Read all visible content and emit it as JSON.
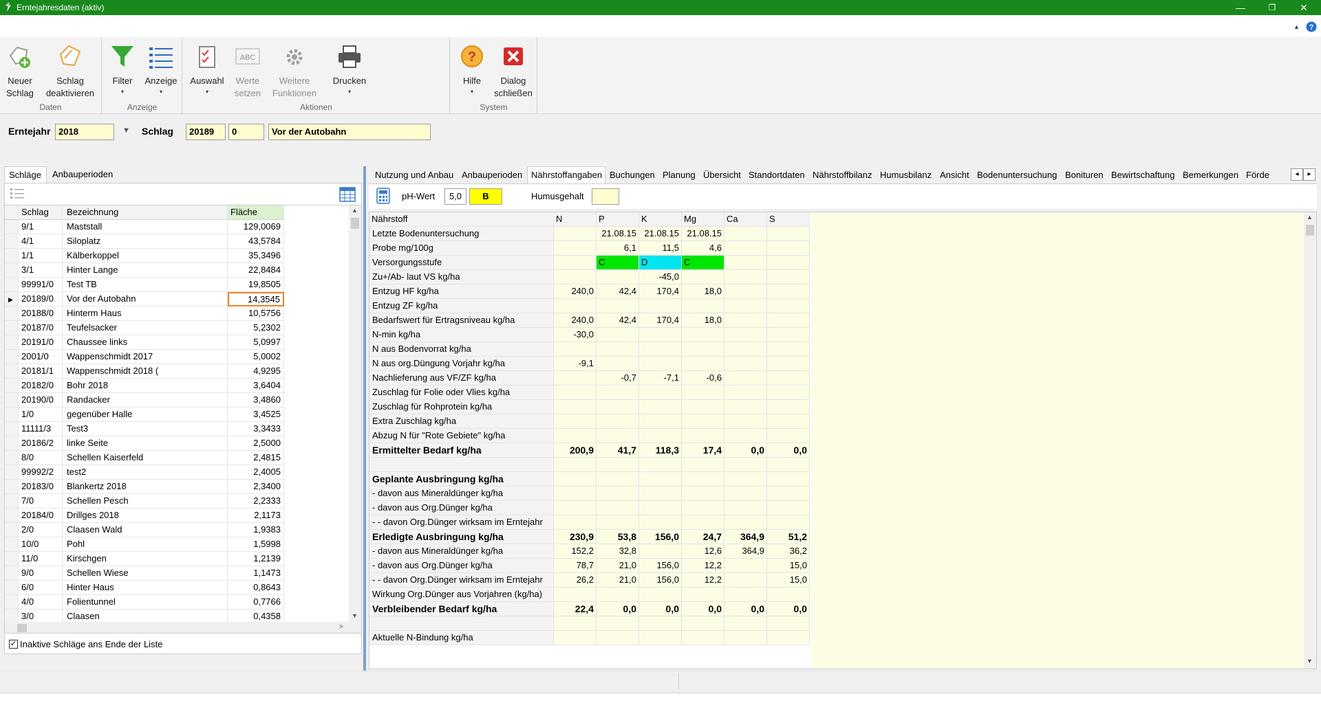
{
  "window": {
    "title": "Erntejahresdaten (aktiv)",
    "minimize": "—",
    "maximize": "❐",
    "close": "✕"
  },
  "ribbon": {
    "groups": {
      "daten": "Daten",
      "anzeige": "Anzeige",
      "aktionen": "Aktionen",
      "system": "System"
    },
    "buttons": {
      "neuer_schlag": "Neuer\nSchlag",
      "schlag_deaktivieren": "Schlag\ndeaktivieren",
      "filter": "Filter",
      "anzeige": "Anzeige",
      "auswahl": "Auswahl",
      "werte_setzen": "Werte\nsetzen",
      "weitere_funktionen": "Weitere\nFunktionen",
      "drucken": "Drucken",
      "hilfe": "Hilfe",
      "dialog_schliessen": "Dialog\nschließen"
    },
    "dropdown_arrow": "▾"
  },
  "header": {
    "erntejahr_label": "Erntejahr",
    "erntejahr_value": "2018",
    "schlag_label": "Schlag",
    "schlag_nr": "20189",
    "schlag_sub": "0",
    "schlag_name": "Vor der Autobahn"
  },
  "left": {
    "tabs": [
      "Schläge",
      "Anbauperioden"
    ],
    "columns": [
      "Schlag",
      "Bezeichnung",
      "Fläche"
    ],
    "rows": [
      [
        "9/1",
        "Maststall",
        "129,0069"
      ],
      [
        "4/1",
        "Siloplatz",
        "43,5784"
      ],
      [
        "1/1",
        "Kälberkoppel",
        "35,3496"
      ],
      [
        "3/1",
        "Hinter Lange",
        "22,8484"
      ],
      [
        "99991/0",
        "Test TB",
        "19,8505"
      ],
      [
        "20189/0",
        "Vor der Autobahn",
        "14,3545"
      ],
      [
        "20188/0",
        "Hinterm Haus",
        "10,5756"
      ],
      [
        "20187/0",
        "Teufelsacker",
        "5,2302"
      ],
      [
        "20191/0",
        "Chaussee links",
        "5,0997"
      ],
      [
        "2001/0",
        "Wappenschmidt 2017",
        "5,0002"
      ],
      [
        "20181/1",
        "Wappenschmidt 2018 (",
        "4,9295"
      ],
      [
        "20182/0",
        "Bohr 2018",
        "3,6404"
      ],
      [
        "20190/0",
        "Randacker",
        "3,4860"
      ],
      [
        "1/0",
        "gegenüber Halle",
        "3,4525"
      ],
      [
        "11111/3",
        "Test3",
        "3,3433"
      ],
      [
        "20186/2",
        "linke Seite",
        "2,5000"
      ],
      [
        "8/0",
        "Schellen Kaiserfeld",
        "2,4815"
      ],
      [
        "99992/2",
        "test2",
        "2,4005"
      ],
      [
        "20183/0",
        "Blankertz 2018",
        "2,3400"
      ],
      [
        "7/0",
        "Schellen Pesch",
        "2,2333"
      ],
      [
        "20184/0",
        "Drillges 2018",
        "2,1173"
      ],
      [
        "2/0",
        "Claasen Wald",
        "1,9383"
      ],
      [
        "10/0",
        "Pohl",
        "1,5998"
      ],
      [
        "11/0",
        "Kirschgen",
        "1,2139"
      ],
      [
        "9/0",
        "Schellen Wiese",
        "1,1473"
      ],
      [
        "6/0",
        "Hinter Haus",
        "0,8643"
      ],
      [
        "4/0",
        "Folientunnel",
        "0,7766"
      ],
      [
        "3/0",
        "Claasen",
        "0,4358"
      ]
    ],
    "current_row_marker": "▶",
    "footer_checkbox": "Inaktive Schläge ans Ende der Liste",
    "footer_checked": "✓"
  },
  "right": {
    "tabs": [
      "Nutzung und Anbau",
      "Anbauperioden",
      "Nährstoffangaben",
      "Buchungen",
      "Planung",
      "Übersicht",
      "Standortdaten",
      "Nährstoffbilanz",
      "Humusbilanz",
      "Ansicht",
      "Bodenuntersuchung",
      "Bonituren",
      "Bewirtschaftung",
      "Bemerkungen",
      "Förde"
    ],
    "active_tab": "Nährstoffangaben",
    "ph_label": "pH-Wert",
    "ph_value": "5,0",
    "ph_class": "B",
    "humus_label": "Humusgehalt",
    "humus_value": "",
    "grid_columns": [
      "Nährstoff",
      "N",
      "P",
      "K",
      "Mg",
      "Ca",
      "S"
    ],
    "grid_rows": [
      {
        "label": "Letzte Bodenuntersuchung",
        "vals": [
          "",
          "21.08.15",
          "21.08.15",
          "21.08.15",
          "",
          ""
        ]
      },
      {
        "label": "Probe mg/100g",
        "vals": [
          "",
          "6,1",
          "11,5",
          "4,6",
          "",
          ""
        ]
      },
      {
        "label": "Versorgungsstufe",
        "vals": [
          "",
          "C",
          "D",
          "C",
          "",
          ""
        ]
      },
      {
        "label": "Zu+/Ab- laut VS kg/ha",
        "vals": [
          "",
          "",
          "-45,0",
          "",
          "",
          ""
        ]
      },
      {
        "label": "Entzug HF kg/ha",
        "vals": [
          "240,0",
          "42,4",
          "170,4",
          "18,0",
          "",
          ""
        ]
      },
      {
        "label": "Entzug ZF kg/ha",
        "vals": [
          "",
          "",
          "",
          "",
          "",
          ""
        ]
      },
      {
        "label": "Bedarfswert für Ertragsniveau kg/ha",
        "vals": [
          "240,0",
          "42,4",
          "170,4",
          "18,0",
          "",
          ""
        ]
      },
      {
        "label": "N-min kg/ha",
        "vals": [
          "-30,0",
          "",
          "",
          "",
          "",
          ""
        ]
      },
      {
        "label": "N aus Bodenvorrat kg/ha",
        "vals": [
          "",
          "",
          "",
          "",
          "",
          ""
        ]
      },
      {
        "label": "N aus org.Düngung Vorjahr kg/ha",
        "vals": [
          "-9,1",
          "",
          "",
          "",
          "",
          ""
        ]
      },
      {
        "label": "Nachlieferung aus VF/ZF kg/ha",
        "vals": [
          "",
          "-0,7",
          "-7,1",
          "-0,6",
          "",
          ""
        ]
      },
      {
        "label": "Zuschlag für Folie oder Vlies kg/ha",
        "vals": [
          "",
          "",
          "",
          "",
          "",
          ""
        ]
      },
      {
        "label": "Zuschlag für Rohprotein kg/ha",
        "vals": [
          "",
          "",
          "",
          "",
          "",
          ""
        ]
      },
      {
        "label": "Extra Zuschlag kg/ha",
        "vals": [
          "",
          "",
          "",
          "",
          "",
          ""
        ]
      },
      {
        "label": "Abzug N für \"Rote Gebiete\" kg/ha",
        "vals": [
          "",
          "",
          "",
          "",
          "",
          ""
        ]
      },
      {
        "label": "Ermittelter Bedarf kg/ha",
        "vals": [
          "200,9",
          "41,7",
          "118,3",
          "17,4",
          "0,0",
          "0,0"
        ],
        "bold": true
      },
      {
        "label": "",
        "vals": [
          "",
          "",
          "",
          "",
          "",
          ""
        ]
      },
      {
        "label": "Geplante Ausbringung kg/ha",
        "vals": [
          "",
          "",
          "",
          "",
          "",
          ""
        ],
        "bold": true
      },
      {
        "label": "- davon aus Mineraldünger kg/ha",
        "vals": [
          "",
          "",
          "",
          "",
          "",
          ""
        ]
      },
      {
        "label": "- davon aus Org.Dünger kg/ha",
        "vals": [
          "",
          "",
          "",
          "",
          "",
          ""
        ]
      },
      {
        "label": "- - davon Org.Dünger wirksam im Erntejahr",
        "vals": [
          "",
          "",
          "",
          "",
          "",
          ""
        ]
      },
      {
        "label": "Erledigte Ausbringung kg/ha",
        "vals": [
          "230,9",
          "53,8",
          "156,0",
          "24,7",
          "364,9",
          "51,2"
        ],
        "bold": true
      },
      {
        "label": "- davon aus Mineraldünger kg/ha",
        "vals": [
          "152,2",
          "32,8",
          "",
          "12,6",
          "364,9",
          "36,2"
        ]
      },
      {
        "label": "- davon aus Org.Dünger kg/ha",
        "vals": [
          "78,7",
          "21,0",
          "156,0",
          "12,2",
          "",
          "15,0"
        ]
      },
      {
        "label": "- - davon Org.Dünger wirksam im Erntejahr",
        "vals": [
          "26,2",
          "21,0",
          "156,0",
          "12,2",
          "",
          "15,0"
        ]
      },
      {
        "label": "Wirkung Org.Dünger aus Vorjahren (kg/ha)",
        "vals": [
          "",
          "",
          "",
          "",
          "",
          ""
        ]
      },
      {
        "label": "Verbleibender Bedarf kg/ha",
        "vals": [
          "22,4",
          "0,0",
          "0,0",
          "0,0",
          "0,0",
          "0,0"
        ],
        "bold": true
      },
      {
        "label": "",
        "vals": [
          "",
          "",
          "",
          "",
          "",
          ""
        ]
      },
      {
        "label": "Aktuelle N-Bindung kg/ha",
        "vals": [
          "",
          "",
          "",
          "",
          "",
          ""
        ]
      }
    ],
    "versorgung_colors": {
      "C": "#00e600",
      "D": "#00e6ef"
    },
    "tab_prev": "◂",
    "tab_next": "▸"
  },
  "colors": {
    "titlebar": "#18891d",
    "accent_orange": "#f08224",
    "input_yellow": "#fdfdd0",
    "ph_class_yellow": "#ffff00",
    "grid_bg": "#fdfde6"
  }
}
